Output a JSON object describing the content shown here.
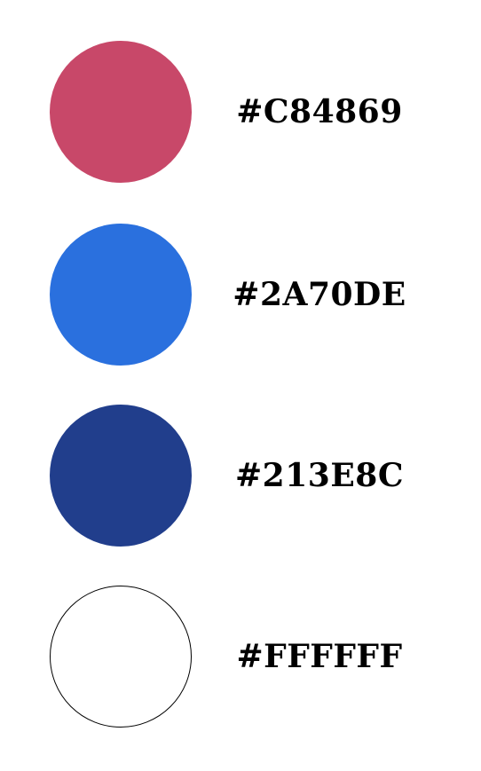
{
  "swatches": [
    {
      "color": "#C84869",
      "label": "#C84869",
      "outlined": false
    },
    {
      "color": "#2A70DE",
      "label": "#2A70DE",
      "outlined": false
    },
    {
      "color": "#213E8C",
      "label": "#213E8C",
      "outlined": false
    },
    {
      "color": "#FFFFFF",
      "label": "#FFFFFF",
      "outlined": true
    }
  ]
}
